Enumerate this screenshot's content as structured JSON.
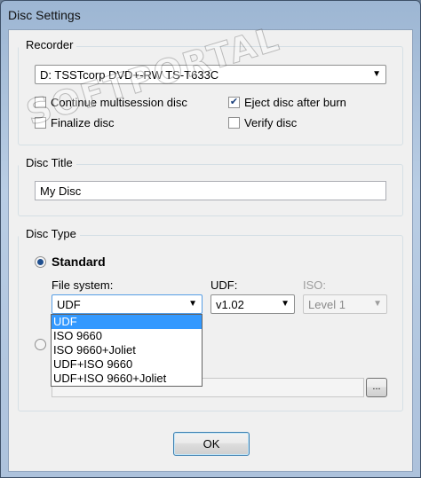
{
  "window": {
    "title": "Disc Settings"
  },
  "watermark": {
    "text": "SOFTPORTAL"
  },
  "recorder": {
    "label": "Recorder",
    "device": "D: TSSTcorp DVD+-RW TS-T633C",
    "options": [
      {
        "label": "Continue multisession disc",
        "checked": false
      },
      {
        "label": "Eject disc after burn",
        "checked": true
      },
      {
        "label": "Finalize disc",
        "checked": false
      },
      {
        "label": "Verify disc",
        "checked": false
      }
    ]
  },
  "disc_title": {
    "label": "Disc Title",
    "value": "My Disc"
  },
  "disc_type": {
    "label": "Disc Type",
    "standard": {
      "label": "Standard",
      "selected": true
    },
    "file_system": {
      "label": "File system:",
      "value": "UDF",
      "options": [
        "UDF",
        "ISO 9660",
        "ISO 9660+Joliet",
        "UDF+ISO 9660",
        "UDF+ISO 9660+Joliet"
      ],
      "highlighted": "UDF"
    },
    "udf": {
      "label": "UDF:",
      "value": "v1.02"
    },
    "iso": {
      "label": "ISO:",
      "value": "Level 1"
    },
    "image_browse_label": "..."
  },
  "ok_button": "OK",
  "icons": {
    "dropdown": "chevron-down-icon",
    "check": "checkmark-icon",
    "radio": "radio-dot-icon"
  }
}
